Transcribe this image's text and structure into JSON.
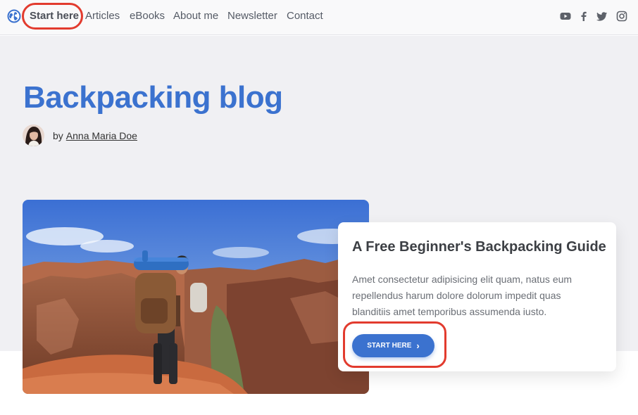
{
  "nav": {
    "items": [
      "Start here",
      "Articles",
      "eBooks",
      "About me",
      "Newsletter",
      "Contact"
    ],
    "social": [
      "youtube-icon",
      "facebook-icon",
      "twitter-icon",
      "instagram-icon"
    ]
  },
  "hero": {
    "title": "Backpacking blog",
    "by": "by",
    "author": "Anna Maria Doe"
  },
  "card": {
    "title": "A Free Beginner's Backpacking Guide",
    "text": "Amet consectetur adipisicing elit quam, natus eum repellendus harum dolore dolorum impedit quas blanditiis amet temporibus assumenda iusto.",
    "cta": "START HERE",
    "cta_icon": "chevron-right-icon"
  },
  "colors": {
    "accent": "#3b72cf",
    "highlight": "#e23b2e",
    "hero_bg": "#f0f0f3"
  }
}
